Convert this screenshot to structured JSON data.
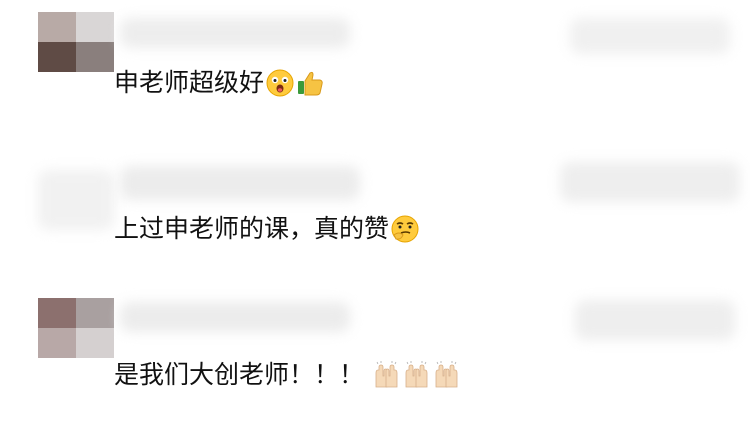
{
  "comments": [
    {
      "text": "申老师超级好",
      "emoji": [
        "laughing-face-emoji",
        "thumbs-up-emoji"
      ]
    },
    {
      "text": "上过申老师的课，真的赞",
      "emoji": [
        "thinking-smirk-face-emoji"
      ]
    },
    {
      "text": "是我们大创老师！！！",
      "emoji": [
        "raised-hands-emoji",
        "raised-hands-emoji",
        "raised-hands-emoji"
      ]
    }
  ],
  "colors": {
    "text": "#111111",
    "avatar_1": [
      "#5f4b45",
      "#8a7f7d"
    ],
    "avatar_3": [
      "#8c706e",
      "#a9a0a0"
    ],
    "blur": "#e4e4e4"
  }
}
